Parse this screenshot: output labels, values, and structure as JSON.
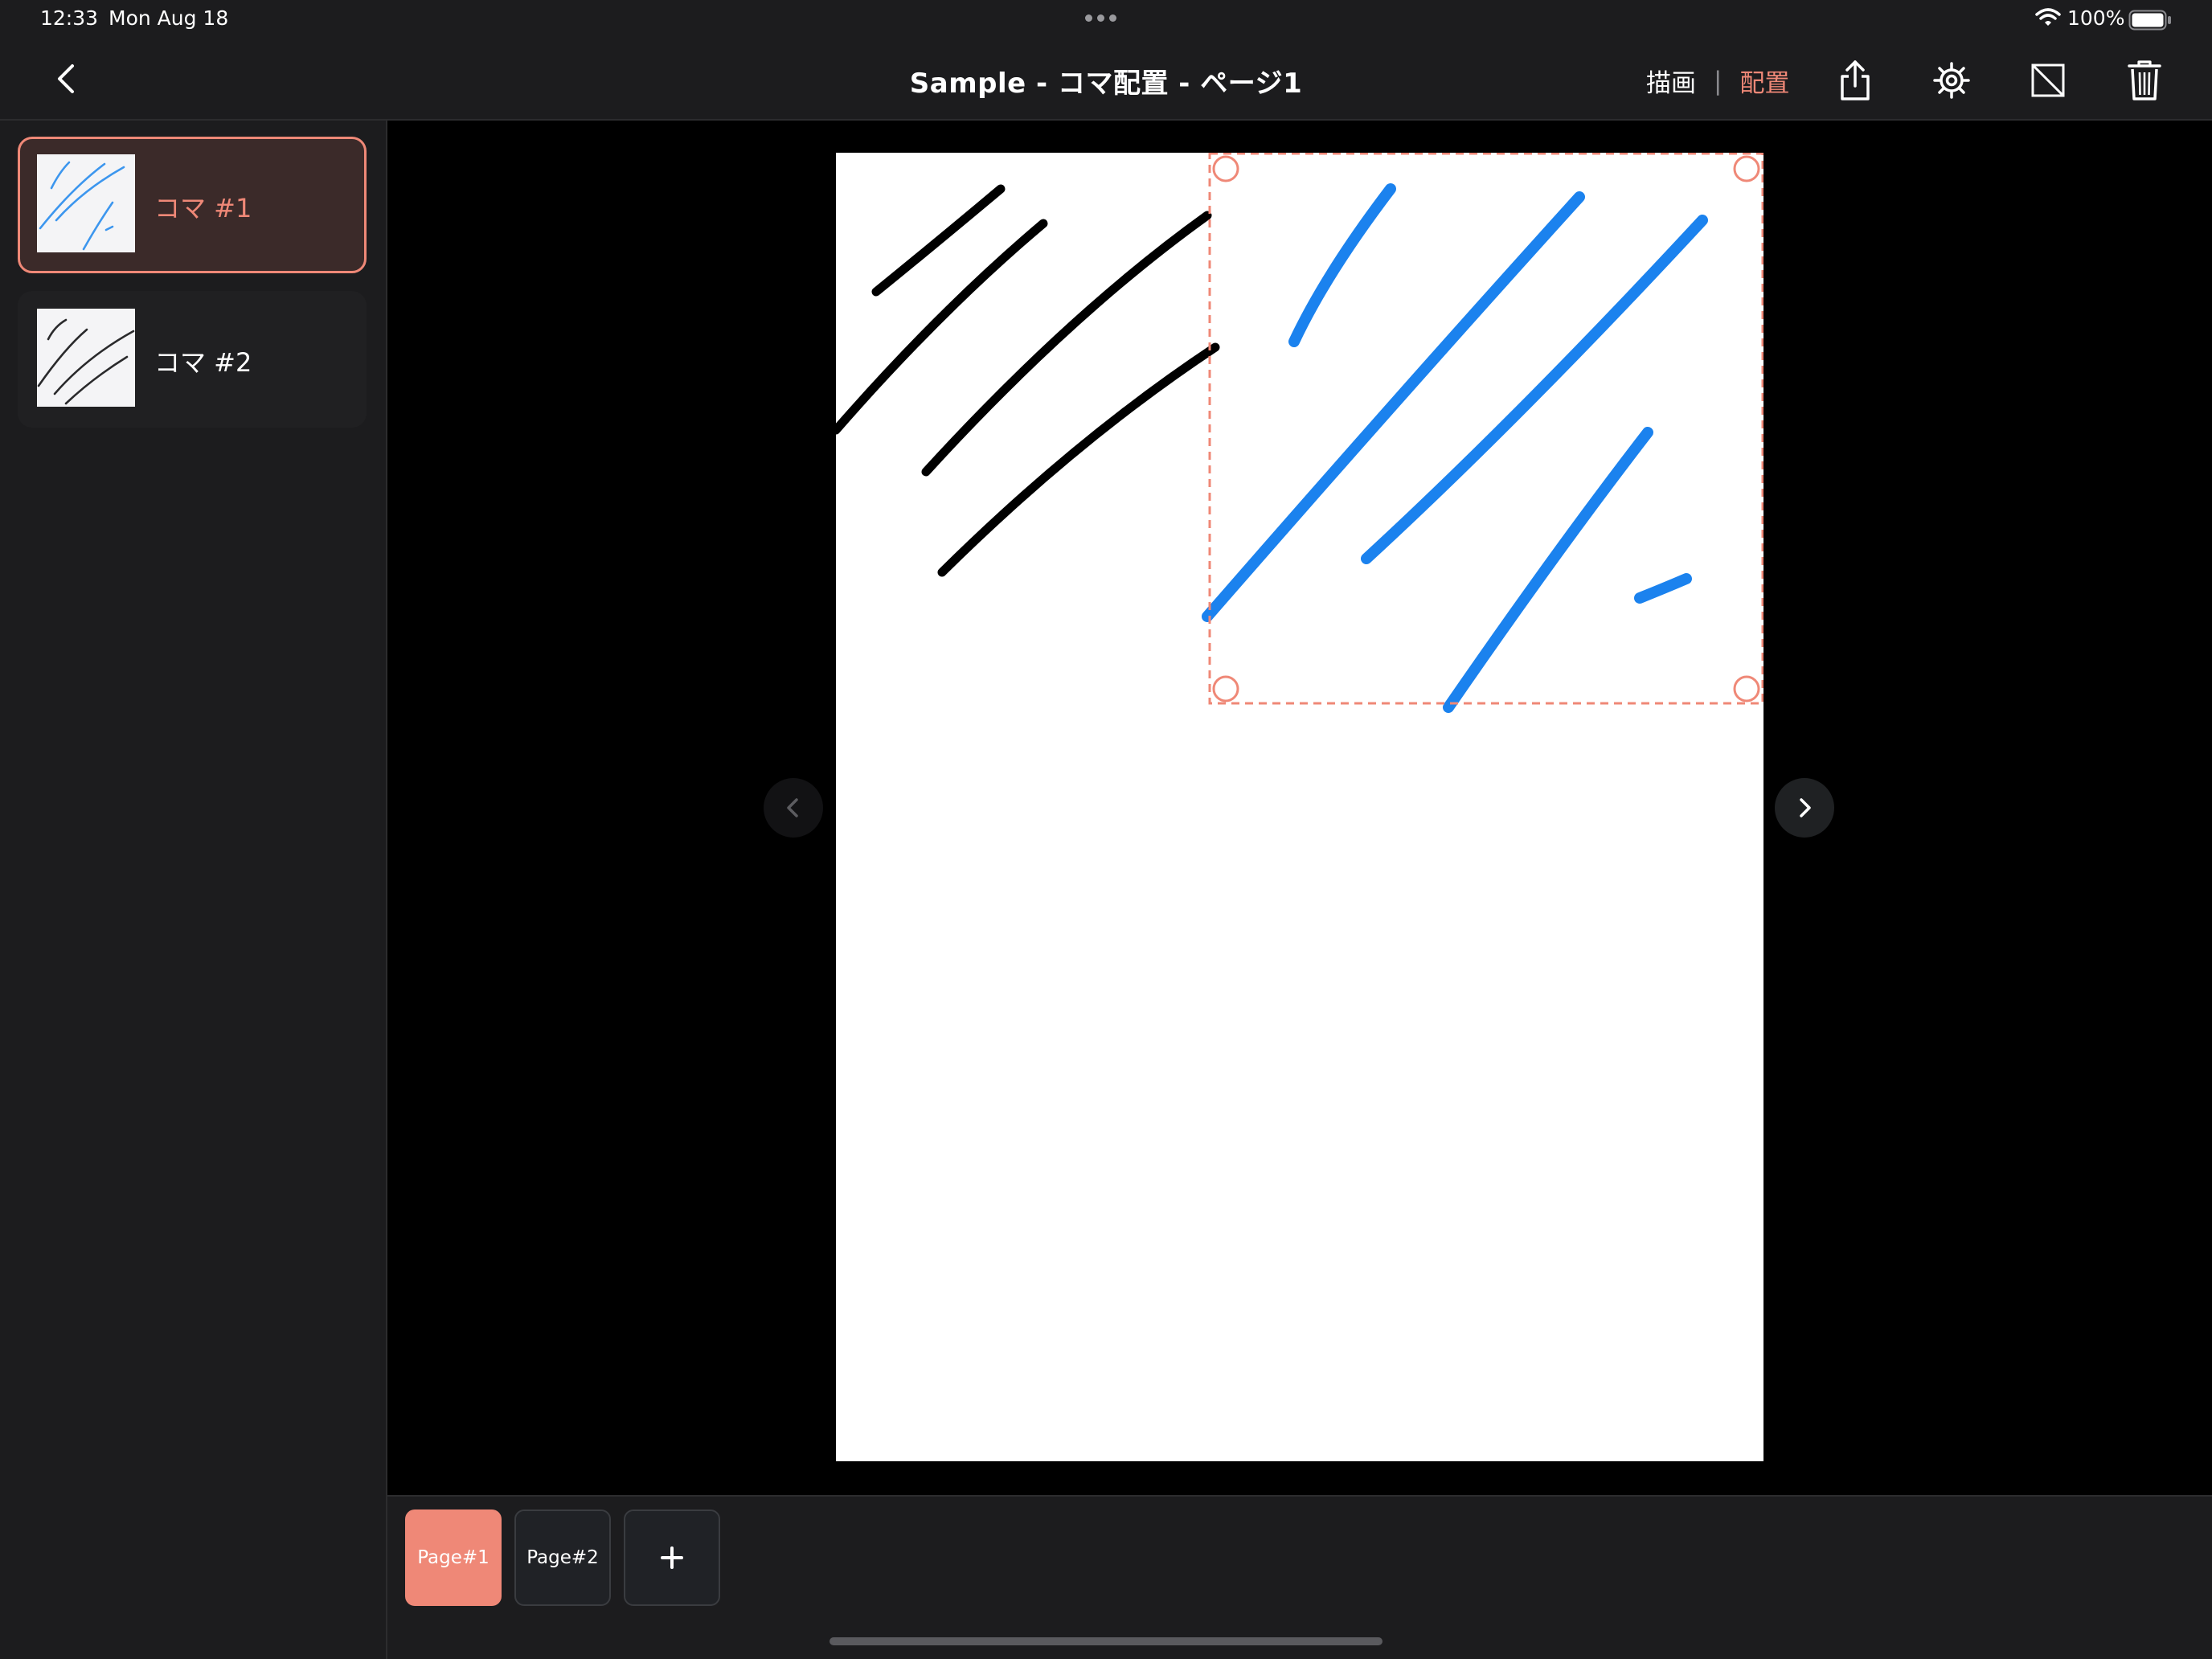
{
  "status_bar": {
    "time": "12:33",
    "date": "Mon Aug 18",
    "battery": "100%"
  },
  "header": {
    "title": "Sample - コマ配置 - ページ1",
    "mode_draw": "描画",
    "mode_separator": "|",
    "mode_layout": "配置"
  },
  "sidebar": {
    "items": [
      {
        "label": "コマ #1",
        "selected": true
      },
      {
        "label": "コマ #2",
        "selected": false
      }
    ]
  },
  "page_bar": {
    "tabs": [
      {
        "label": "Page#1",
        "active": true
      },
      {
        "label": "Page#2",
        "active": false
      }
    ],
    "add_label": "+"
  },
  "icons": {
    "back": "chevron-left-icon",
    "share": "share-icon",
    "settings": "gear-icon",
    "panel_toggle": "panel-off-icon",
    "trash": "trash-icon",
    "prev": "chevron-left-icon",
    "next": "chevron-right-icon",
    "add": "plus-icon"
  },
  "colors": {
    "accent": "#ef8877",
    "selection_border": "#ef8877",
    "blue_ink": "#1b82ee",
    "black_ink": "#000000"
  }
}
